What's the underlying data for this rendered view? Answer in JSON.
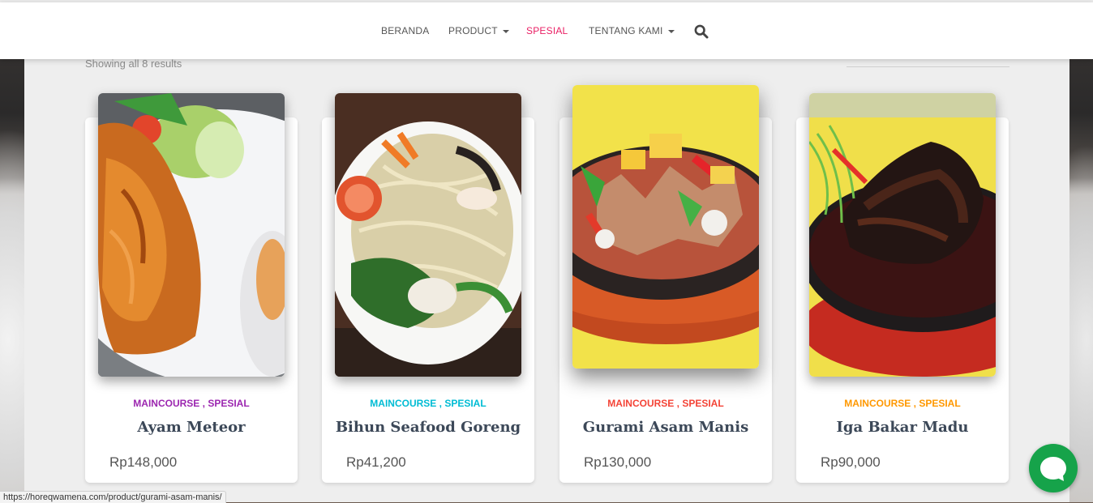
{
  "nav": {
    "items": [
      {
        "label": "BERANDA",
        "dropdown": false,
        "active": false
      },
      {
        "label": "PRODUCT",
        "dropdown": true,
        "active": false
      },
      {
        "label": "SPESIAL",
        "dropdown": false,
        "active": true
      },
      {
        "label": "TENTANG KAMI",
        "dropdown": true,
        "active": false
      }
    ],
    "search_icon": "search-icon"
  },
  "shop": {
    "results_text": "Showing all 8 results"
  },
  "products": [
    {
      "cat1": "MAINCOURSE",
      "sep": " , ",
      "cat2": "SPESIAL",
      "color": "#9c27b0",
      "title": "Ayam Meteor",
      "price": "Rp148,000"
    },
    {
      "cat1": "MAINCOURSE",
      "sep": " , ",
      "cat2": "SPESIAL",
      "color": "#00bcd4",
      "title": "Bihun Seafood Goreng",
      "price": "Rp41,200"
    },
    {
      "cat1": "MAINCOURSE",
      "sep": " , ",
      "cat2": "SPESIAL",
      "color": "#f44336",
      "title": "Gurami Asam Manis",
      "price": "Rp130,000"
    },
    {
      "cat1": "MAINCOURSE",
      "sep": " , ",
      "cat2": "SPESIAL",
      "color": "#ff9800",
      "title": "Iga Bakar Madu",
      "price": "Rp90,000"
    }
  ],
  "chat": {
    "icon": "chat-bubble-icon",
    "color": "#16a34a"
  },
  "status_bar": {
    "url": "https://horeqwamena.com/product/gurami-asam-manis/"
  },
  "colors": {
    "accent": "#e91e63",
    "title": "#3c4858"
  }
}
